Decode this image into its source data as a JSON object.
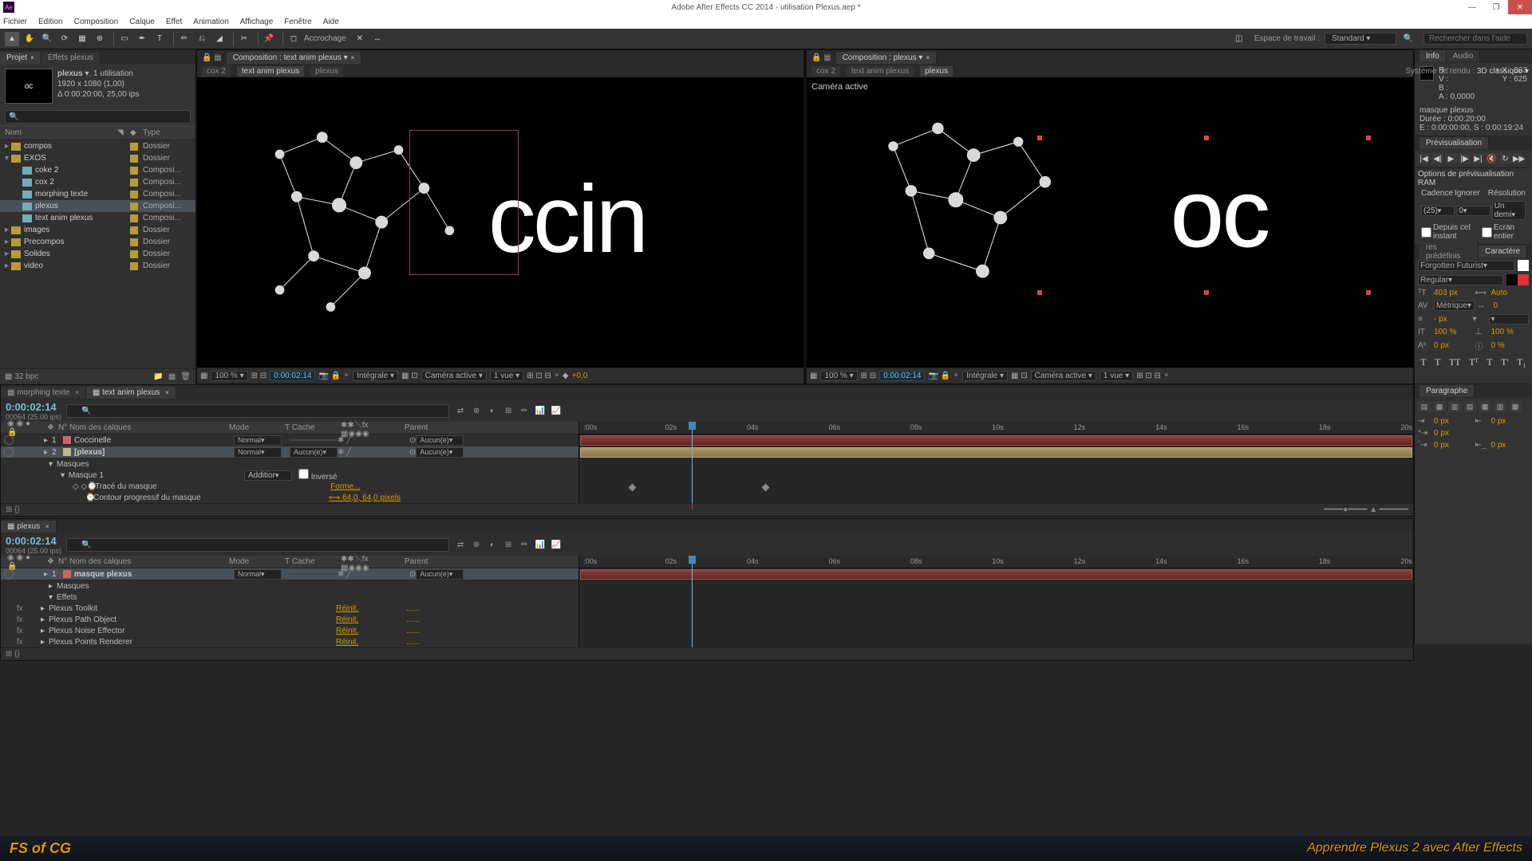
{
  "title": "Adobe After Effects CC 2014 - utilisation Plexus.aep *",
  "menu": [
    "Fichier",
    "Edition",
    "Composition",
    "Calque",
    "Effet",
    "Animation",
    "Affichage",
    "Fenêtre",
    "Aide"
  ],
  "toolbar": {
    "anchor": "Accrochage"
  },
  "workspace": {
    "label": "Espace de travail :",
    "value": "Standard"
  },
  "search_ph": "Rechercher dans l'aide",
  "project": {
    "tab1": "Projet",
    "tab2": "Effets plexus",
    "meta_name": "plexus",
    "meta_uses": ", 1 utilisation",
    "meta_dim": "1920 x 1080 (1,00)",
    "meta_dur": "Δ 0:00:20:00, 25,00 ips",
    "thumb_text": "oc",
    "hdr_name": "Nom",
    "hdr_type": "Type",
    "items": [
      {
        "i": 0,
        "name": "compos",
        "type": "Dossier",
        "folder": true,
        "tri": "▸"
      },
      {
        "i": 1,
        "name": "EXOS",
        "type": "Dossier",
        "folder": true,
        "tri": "▾"
      },
      {
        "i": 2,
        "name": "coke 2",
        "type": "Composi...",
        "folder": false,
        "indent": 1
      },
      {
        "i": 3,
        "name": "cox 2",
        "type": "Composi...",
        "folder": false,
        "indent": 1
      },
      {
        "i": 4,
        "name": "morphing texte",
        "type": "Composi...",
        "folder": false,
        "indent": 1
      },
      {
        "i": 5,
        "name": "plexus",
        "type": "Composi...",
        "folder": false,
        "indent": 1,
        "sel": true
      },
      {
        "i": 6,
        "name": "text anim plexus",
        "type": "Composi...",
        "folder": false,
        "indent": 1
      },
      {
        "i": 7,
        "name": "images",
        "type": "Dossier",
        "folder": true,
        "tri": "▸"
      },
      {
        "i": 8,
        "name": "Precompos",
        "type": "Dossier",
        "folder": true,
        "tri": "▸"
      },
      {
        "i": 9,
        "name": "Solides",
        "type": "Dossier",
        "folder": true,
        "tri": "▸"
      },
      {
        "i": 10,
        "name": "video",
        "type": "Dossier",
        "folder": true,
        "tri": "▸"
      }
    ],
    "bpc": "32 bpc"
  },
  "viewer1": {
    "tab": "Composition : text anim plexus",
    "crumbs": [
      "cox 2",
      "text anim plexus",
      "plexus"
    ],
    "crumb_active": 1,
    "zoom": "100 %",
    "tc": "0:00:02:14",
    "res": "Intégrale",
    "cam": "Caméra active",
    "vues": "1 vue",
    "exp": "+0,0",
    "text": "ccin"
  },
  "viewer2": {
    "tab": "Composition : plexus",
    "crumbs": [
      "cox 2",
      "text anim plexus",
      "plexus"
    ],
    "crumb_active": 2,
    "cam_label": "Caméra active",
    "render_label": "Système de rendu :",
    "render_val": "3D classique",
    "zoom": "100 %",
    "tc": "0:00:02:14",
    "res": "Intégrale",
    "cam": "Caméra active",
    "vues": "1 vue",
    "text": "oc"
  },
  "info": {
    "tab1": "Info",
    "tab2": "Audio",
    "R": "R :",
    "V": "V :",
    "B": "B :",
    "A": "A :",
    "aval": "0,0000",
    "X": "X : 863",
    "Y": "Y : 625",
    "layer": "masque plexus",
    "dur": "Durée : 0:00:20:00",
    "es": "E : 0:00:00:00, S : 0:00:19:24"
  },
  "preview": {
    "tab": "Prévisualisation"
  },
  "ram": {
    "title": "Options de prévisualisation RAM",
    "c1": "Cadence",
    "c2": "Ignorer",
    "c3": "Résolution",
    "v1": "(25)",
    "v2": "0",
    "v3": "Un demi",
    "cb1": "Depuis cet instant",
    "cb2": "Ecran entier"
  },
  "char": {
    "tab1": "res prédéfinis",
    "tab2": "Caractère",
    "font": "Forgotten Futurist",
    "style": "Regular",
    "size": "403 px",
    "auto": "Auto",
    "tracking": "Métrique",
    "tval": "0",
    "dash": "- px",
    "scale": "100 %",
    "scale2": "100 %",
    "pt": "0 px",
    "pct": "0 %",
    "styles": [
      "T",
      "T",
      "TT",
      "Tᵀ",
      "T",
      "T'",
      "T₁"
    ]
  },
  "para": {
    "tab": "Paragraphe",
    "px": "0 px"
  },
  "timeline1": {
    "tabs": [
      "morphing texte",
      "text anim plexus"
    ],
    "active": 1,
    "tc": "0:00:02:14",
    "sub": "00064 (25.00 ips)",
    "hdr_mode": "Mode",
    "hdr_cache": "T   Cache",
    "hdr_parent": "Parent",
    "hdr_src": "Nom des calques",
    "layers": [
      {
        "n": "1",
        "name": "Coccinelle",
        "mode": "Normal",
        "parent": "Aucun(e)",
        "color": "r"
      },
      {
        "n": "2",
        "name": "[plexus]",
        "mode": "Normal",
        "cache": "Aucun(e)",
        "parent": "Aucun(e)",
        "color": "y",
        "sel": true
      }
    ],
    "sub1": "Masques",
    "sub2": "Masque 1",
    "sub2_mode": "Additior",
    "sub2_inv": "Inversé",
    "sub3": "Tracé du masque",
    "sub3_val": "Forme...",
    "sub4": "Contour progressif du masque",
    "sub4_val": "64,0, 64,0 pixels",
    "ticks": [
      ":00s",
      "02s",
      "04s",
      "06s",
      "08s",
      "10s",
      "12s",
      "14s",
      "16s",
      "18s",
      "20s"
    ]
  },
  "timeline2": {
    "tabs": [
      "plexus"
    ],
    "tc": "0:00:02:14",
    "sub": "00064 (25.00 ips)",
    "layers": [
      {
        "n": "1",
        "name": "masque plexus",
        "mode": "Normal",
        "parent": "Aucun(e)",
        "color": "r",
        "sel": true
      }
    ],
    "sub1": "Masques",
    "sub2": "Effets",
    "fx": [
      "Plexus Toolkit",
      "Plexus Path Object",
      "Plexus Noise Effector",
      "Plexus Points Renderer"
    ],
    "reset": "Réinit.",
    "dots": "......"
  },
  "footer": {
    "logo": "FS of CG",
    "text": "Apprendre Plexus 2 avec After Effects"
  }
}
